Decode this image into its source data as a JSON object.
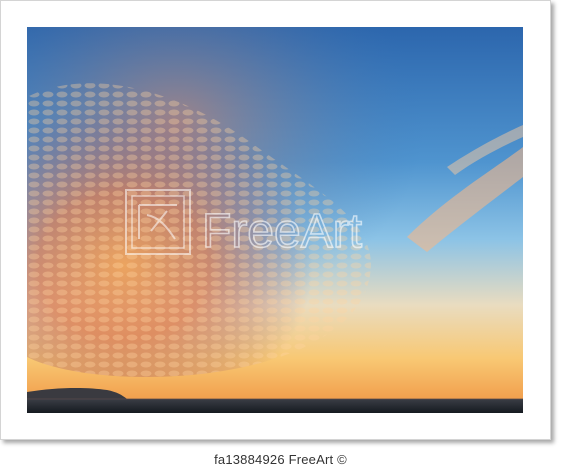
{
  "watermark": {
    "logo_text": "FreeArt"
  },
  "caption": {
    "text": "fa13884926 FreeArt ©"
  },
  "colors": {
    "sky_top": "#2f6fb3",
    "sky_mid": "#6fb0e0",
    "horizon_glow": "#f7c16b",
    "cloud_orange": "#e58a50",
    "sea": "#20262e",
    "headland": "#3a3a40"
  }
}
